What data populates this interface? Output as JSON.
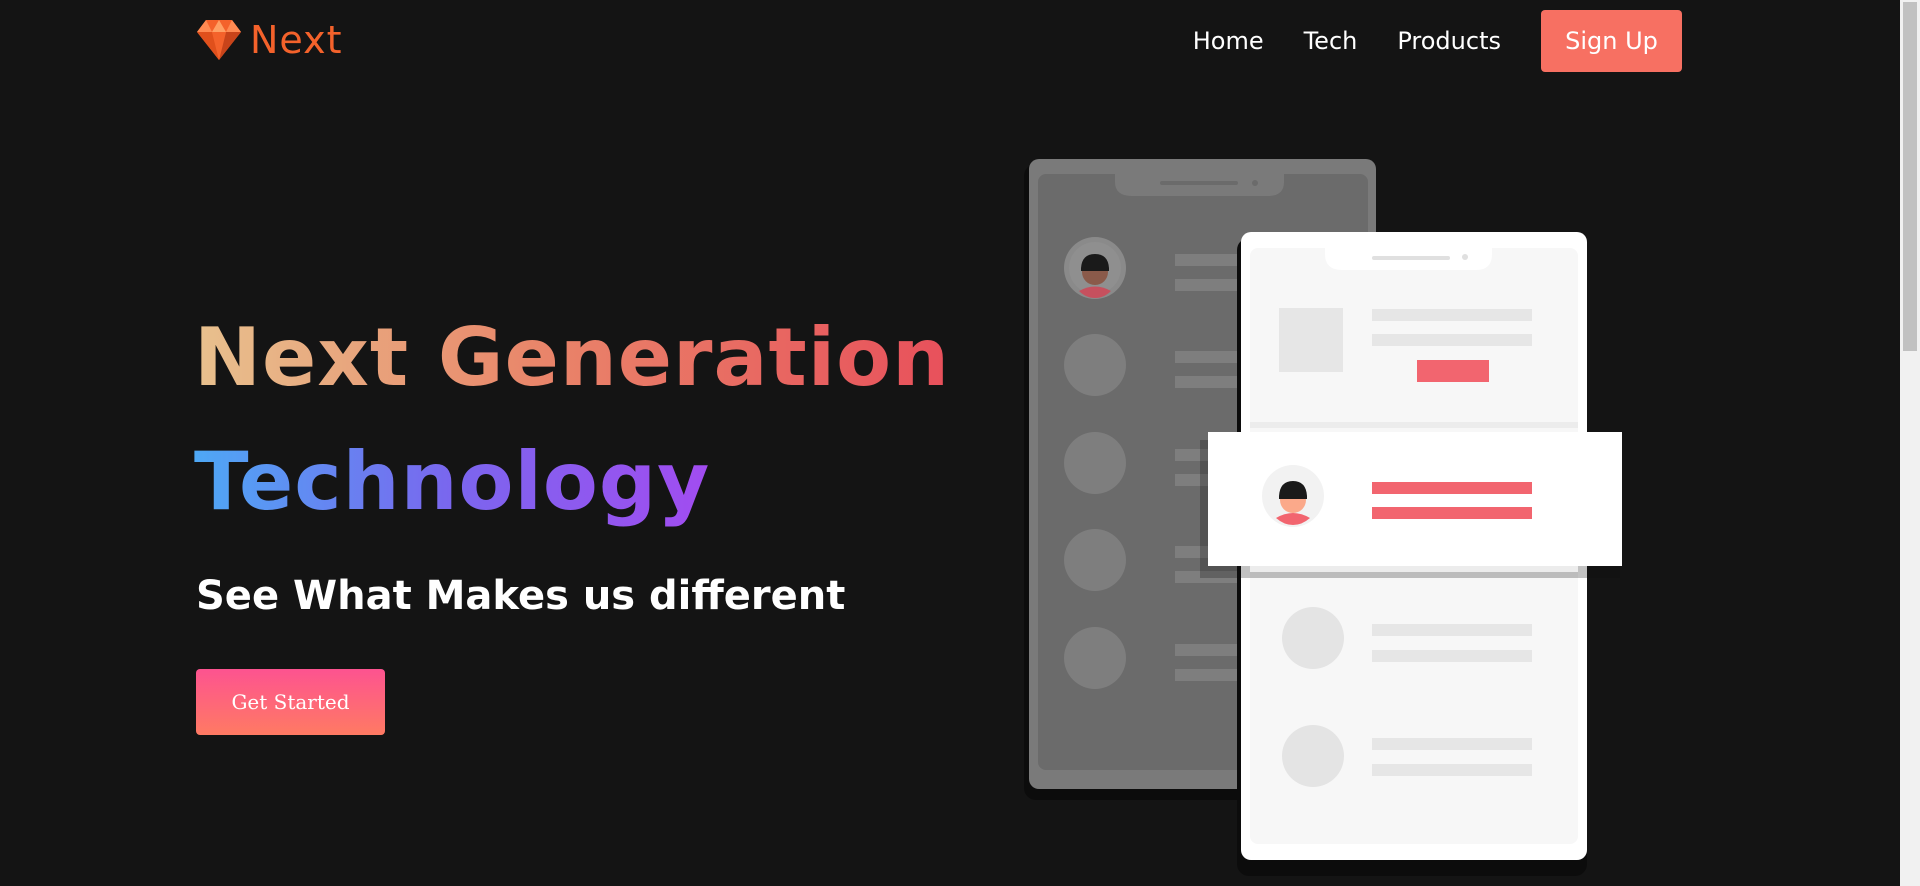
{
  "brand": {
    "name": "Next",
    "logo_icon": "diamond-icon",
    "color": "#f4622b"
  },
  "nav": {
    "links": [
      "Home",
      "Tech",
      "Products"
    ],
    "signup_label": "Sign Up",
    "signup_color": "#f77062"
  },
  "hero": {
    "title_line_1": "Next Generation",
    "title_line_2": "Technology",
    "subtitle": "See What Makes us different",
    "cta_label": "Get Started"
  },
  "illustration": {
    "name": "phone-list-illustration",
    "accent_color": "#f2656f"
  },
  "colors": {
    "background": "#141414",
    "cta_gradient_start": "#fd5390",
    "cta_gradient_end": "#ff7a63"
  }
}
